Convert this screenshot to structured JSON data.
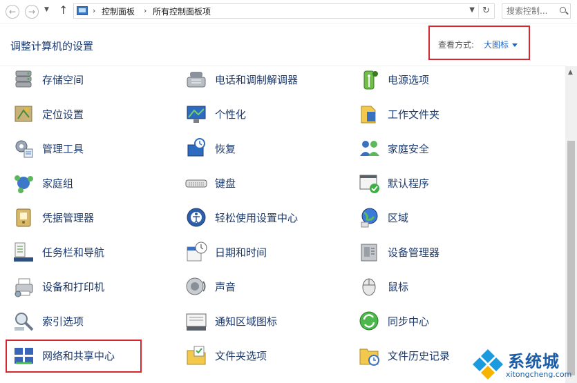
{
  "address": {
    "back_icon": "back-arrow-icon",
    "forward_icon": "forward-arrow-icon",
    "path": [
      "控制面板",
      "所有控制面板项"
    ],
    "search_placeholder": "搜索控制..."
  },
  "header": {
    "title": "调整计算机的设置",
    "view_label": "查看方式:",
    "view_value": "大图标"
  },
  "columns": [
    [
      {
        "label": "存储空间",
        "icon": "storage-spaces-icon"
      },
      {
        "label": "定位设置",
        "icon": "location-settings-icon"
      },
      {
        "label": "管理工具",
        "icon": "admin-tools-icon"
      },
      {
        "label": "家庭组",
        "icon": "homegroup-icon"
      },
      {
        "label": "凭据管理器",
        "icon": "credential-manager-icon"
      },
      {
        "label": "任务栏和导航",
        "icon": "taskbar-icon"
      },
      {
        "label": "设备和打印机",
        "icon": "devices-printers-icon"
      },
      {
        "label": "索引选项",
        "icon": "indexing-icon"
      },
      {
        "label": "网络和共享中心",
        "icon": "network-sharing-icon"
      }
    ],
    [
      {
        "label": "电话和调制解调器",
        "icon": "phone-modem-icon"
      },
      {
        "label": "个性化",
        "icon": "personalization-icon"
      },
      {
        "label": "恢复",
        "icon": "recovery-icon"
      },
      {
        "label": "键盘",
        "icon": "keyboard-icon"
      },
      {
        "label": "轻松使用设置中心",
        "icon": "ease-of-access-icon"
      },
      {
        "label": "日期和时间",
        "icon": "date-time-icon"
      },
      {
        "label": "声音",
        "icon": "sound-icon"
      },
      {
        "label": "通知区域图标",
        "icon": "notification-area-icon"
      },
      {
        "label": "文件夹选项",
        "icon": "folder-options-icon"
      }
    ],
    [
      {
        "label": "电源选项",
        "icon": "power-options-icon"
      },
      {
        "label": "工作文件夹",
        "icon": "work-folders-icon"
      },
      {
        "label": "家庭安全",
        "icon": "family-safety-icon"
      },
      {
        "label": "默认程序",
        "icon": "default-programs-icon"
      },
      {
        "label": "区域",
        "icon": "region-icon"
      },
      {
        "label": "设备管理器",
        "icon": "device-manager-icon"
      },
      {
        "label": "鼠标",
        "icon": "mouse-icon"
      },
      {
        "label": "同步中心",
        "icon": "sync-center-icon"
      },
      {
        "label": "文件历史记录",
        "icon": "file-history-icon"
      }
    ]
  ],
  "watermark": {
    "name": "系统城",
    "url": "xitongcheng.com"
  }
}
